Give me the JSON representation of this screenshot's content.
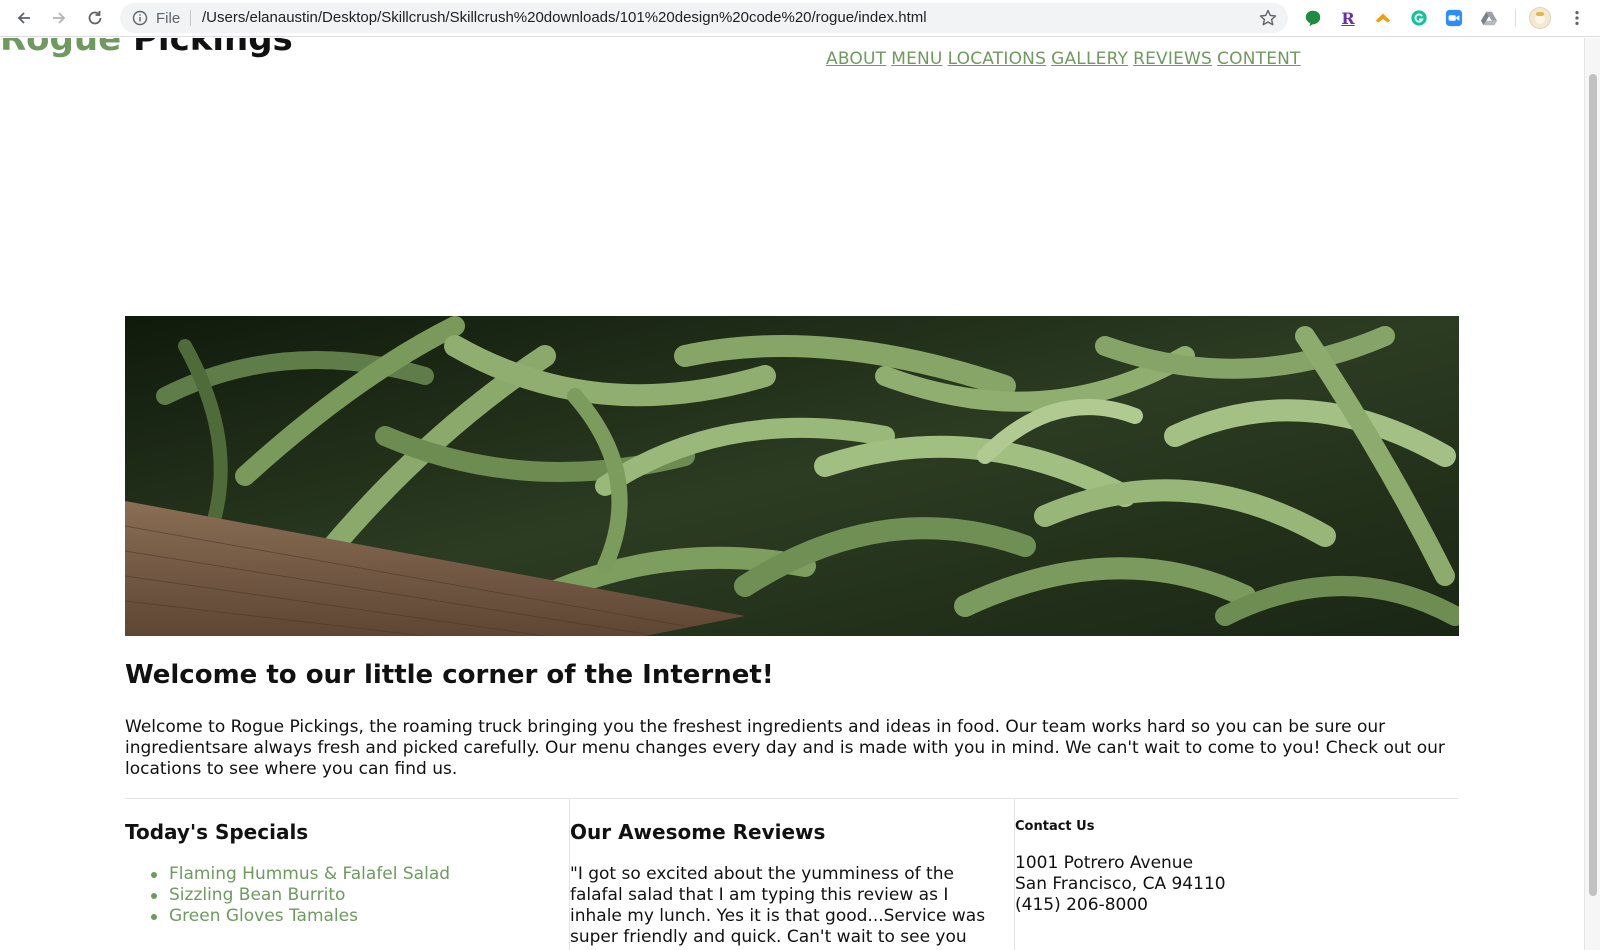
{
  "browser": {
    "file_label": "File",
    "url": "/Users/elanaustin/Desktop/Skillcrush/Skillcrush%20downloads/101%20design%20code%20/rogue/index.html",
    "extensions": [
      "green-leaf-extension-icon",
      "r-extension-icon",
      "honey-extension-icon",
      "grammarly-extension-icon",
      "zoom-extension-icon",
      "drive-extension-icon",
      "profile-avatar-icon"
    ]
  },
  "site": {
    "logo_part1": "Rogue",
    "logo_part2": "Pickings",
    "nav": [
      "ABOUT",
      "MENU",
      "LOCATIONS",
      "GALLERY",
      "REVIEWS",
      "CONTENT"
    ],
    "accent_color": "#6f9a5f"
  },
  "main": {
    "hero_image": "green-beans-photo",
    "welcome_heading": "Welcome to our little corner of the Internet!",
    "welcome_text": "Welcome to Rogue Pickings, the roaming truck bringing you the freshest ingredients and ideas in food. Our team works hard so you can be sure our ingredientsare always fresh and picked carefully. Our menu changes every day and is made with you in mind. We can't wait to come to you! Check out our locations to see where you can find us."
  },
  "specials": {
    "heading": "Today's Specials",
    "items": [
      "Flaming Hummus & Falafel Salad",
      "Sizzling Bean Burrito",
      "Green Gloves Tamales"
    ]
  },
  "reviews": {
    "heading": "Our Awesome Reviews",
    "text": "\"I got so excited about the yumminess of the falafal salad that I am typing this review as I inhale my lunch. Yes it is that good...Service was super friendly and quick. Can't wait to see you"
  },
  "contact": {
    "heading": "Contact Us",
    "address1": "1001 Potrero Avenue",
    "address2": "San Francisco, CA 94110",
    "phone": "(415) 206-8000"
  }
}
